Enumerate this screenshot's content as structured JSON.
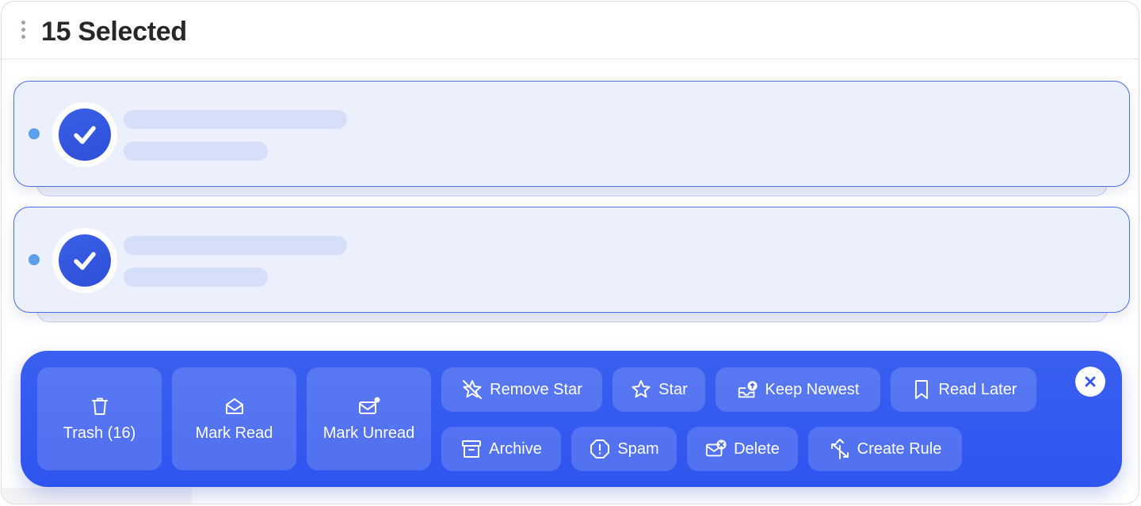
{
  "header": {
    "title": "15 Selected",
    "drag_icon": "drag-handle-icon"
  },
  "emails": [
    {
      "selected": true,
      "unread": true
    },
    {
      "selected": true,
      "unread": true
    }
  ],
  "actions": {
    "trash": "Trash (16)",
    "mark_read": "Mark Read",
    "mark_unread": "Mark Unread",
    "remove_star": "Remove Star",
    "star": "Star",
    "keep_newest": "Keep Newest",
    "read_later": "Read Later",
    "archive": "Archive",
    "spam": "Spam",
    "delete": "Delete",
    "create_rule": "Create Rule"
  },
  "colors": {
    "accent": "#2f55f0",
    "card_border": "#4a6ee0",
    "card_bg": "#ecf0fc",
    "unread_dot": "#5aa0ec"
  }
}
